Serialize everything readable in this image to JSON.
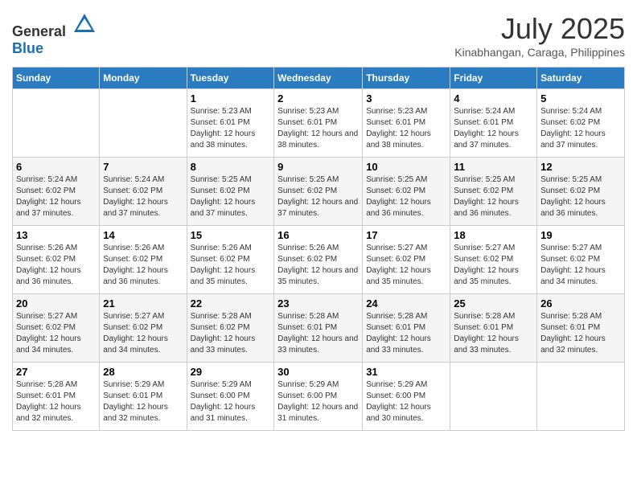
{
  "header": {
    "logo": {
      "text_general": "General",
      "text_blue": "Blue"
    },
    "title": "July 2025",
    "location": "Kinabhangan, Caraga, Philippines"
  },
  "calendar": {
    "days_of_week": [
      "Sunday",
      "Monday",
      "Tuesday",
      "Wednesday",
      "Thursday",
      "Friday",
      "Saturday"
    ],
    "weeks": [
      [
        {
          "day": "",
          "info": ""
        },
        {
          "day": "",
          "info": ""
        },
        {
          "day": "1",
          "info": "Sunrise: 5:23 AM\nSunset: 6:01 PM\nDaylight: 12 hours and 38 minutes."
        },
        {
          "day": "2",
          "info": "Sunrise: 5:23 AM\nSunset: 6:01 PM\nDaylight: 12 hours and 38 minutes."
        },
        {
          "day": "3",
          "info": "Sunrise: 5:23 AM\nSunset: 6:01 PM\nDaylight: 12 hours and 38 minutes."
        },
        {
          "day": "4",
          "info": "Sunrise: 5:24 AM\nSunset: 6:01 PM\nDaylight: 12 hours and 37 minutes."
        },
        {
          "day": "5",
          "info": "Sunrise: 5:24 AM\nSunset: 6:02 PM\nDaylight: 12 hours and 37 minutes."
        }
      ],
      [
        {
          "day": "6",
          "info": "Sunrise: 5:24 AM\nSunset: 6:02 PM\nDaylight: 12 hours and 37 minutes."
        },
        {
          "day": "7",
          "info": "Sunrise: 5:24 AM\nSunset: 6:02 PM\nDaylight: 12 hours and 37 minutes."
        },
        {
          "day": "8",
          "info": "Sunrise: 5:25 AM\nSunset: 6:02 PM\nDaylight: 12 hours and 37 minutes."
        },
        {
          "day": "9",
          "info": "Sunrise: 5:25 AM\nSunset: 6:02 PM\nDaylight: 12 hours and 37 minutes."
        },
        {
          "day": "10",
          "info": "Sunrise: 5:25 AM\nSunset: 6:02 PM\nDaylight: 12 hours and 36 minutes."
        },
        {
          "day": "11",
          "info": "Sunrise: 5:25 AM\nSunset: 6:02 PM\nDaylight: 12 hours and 36 minutes."
        },
        {
          "day": "12",
          "info": "Sunrise: 5:25 AM\nSunset: 6:02 PM\nDaylight: 12 hours and 36 minutes."
        }
      ],
      [
        {
          "day": "13",
          "info": "Sunrise: 5:26 AM\nSunset: 6:02 PM\nDaylight: 12 hours and 36 minutes."
        },
        {
          "day": "14",
          "info": "Sunrise: 5:26 AM\nSunset: 6:02 PM\nDaylight: 12 hours and 36 minutes."
        },
        {
          "day": "15",
          "info": "Sunrise: 5:26 AM\nSunset: 6:02 PM\nDaylight: 12 hours and 35 minutes."
        },
        {
          "day": "16",
          "info": "Sunrise: 5:26 AM\nSunset: 6:02 PM\nDaylight: 12 hours and 35 minutes."
        },
        {
          "day": "17",
          "info": "Sunrise: 5:27 AM\nSunset: 6:02 PM\nDaylight: 12 hours and 35 minutes."
        },
        {
          "day": "18",
          "info": "Sunrise: 5:27 AM\nSunset: 6:02 PM\nDaylight: 12 hours and 35 minutes."
        },
        {
          "day": "19",
          "info": "Sunrise: 5:27 AM\nSunset: 6:02 PM\nDaylight: 12 hours and 34 minutes."
        }
      ],
      [
        {
          "day": "20",
          "info": "Sunrise: 5:27 AM\nSunset: 6:02 PM\nDaylight: 12 hours and 34 minutes."
        },
        {
          "day": "21",
          "info": "Sunrise: 5:27 AM\nSunset: 6:02 PM\nDaylight: 12 hours and 34 minutes."
        },
        {
          "day": "22",
          "info": "Sunrise: 5:28 AM\nSunset: 6:02 PM\nDaylight: 12 hours and 33 minutes."
        },
        {
          "day": "23",
          "info": "Sunrise: 5:28 AM\nSunset: 6:01 PM\nDaylight: 12 hours and 33 minutes."
        },
        {
          "day": "24",
          "info": "Sunrise: 5:28 AM\nSunset: 6:01 PM\nDaylight: 12 hours and 33 minutes."
        },
        {
          "day": "25",
          "info": "Sunrise: 5:28 AM\nSunset: 6:01 PM\nDaylight: 12 hours and 33 minutes."
        },
        {
          "day": "26",
          "info": "Sunrise: 5:28 AM\nSunset: 6:01 PM\nDaylight: 12 hours and 32 minutes."
        }
      ],
      [
        {
          "day": "27",
          "info": "Sunrise: 5:28 AM\nSunset: 6:01 PM\nDaylight: 12 hours and 32 minutes."
        },
        {
          "day": "28",
          "info": "Sunrise: 5:29 AM\nSunset: 6:01 PM\nDaylight: 12 hours and 32 minutes."
        },
        {
          "day": "29",
          "info": "Sunrise: 5:29 AM\nSunset: 6:00 PM\nDaylight: 12 hours and 31 minutes."
        },
        {
          "day": "30",
          "info": "Sunrise: 5:29 AM\nSunset: 6:00 PM\nDaylight: 12 hours and 31 minutes."
        },
        {
          "day": "31",
          "info": "Sunrise: 5:29 AM\nSunset: 6:00 PM\nDaylight: 12 hours and 30 minutes."
        },
        {
          "day": "",
          "info": ""
        },
        {
          "day": "",
          "info": ""
        }
      ]
    ]
  }
}
